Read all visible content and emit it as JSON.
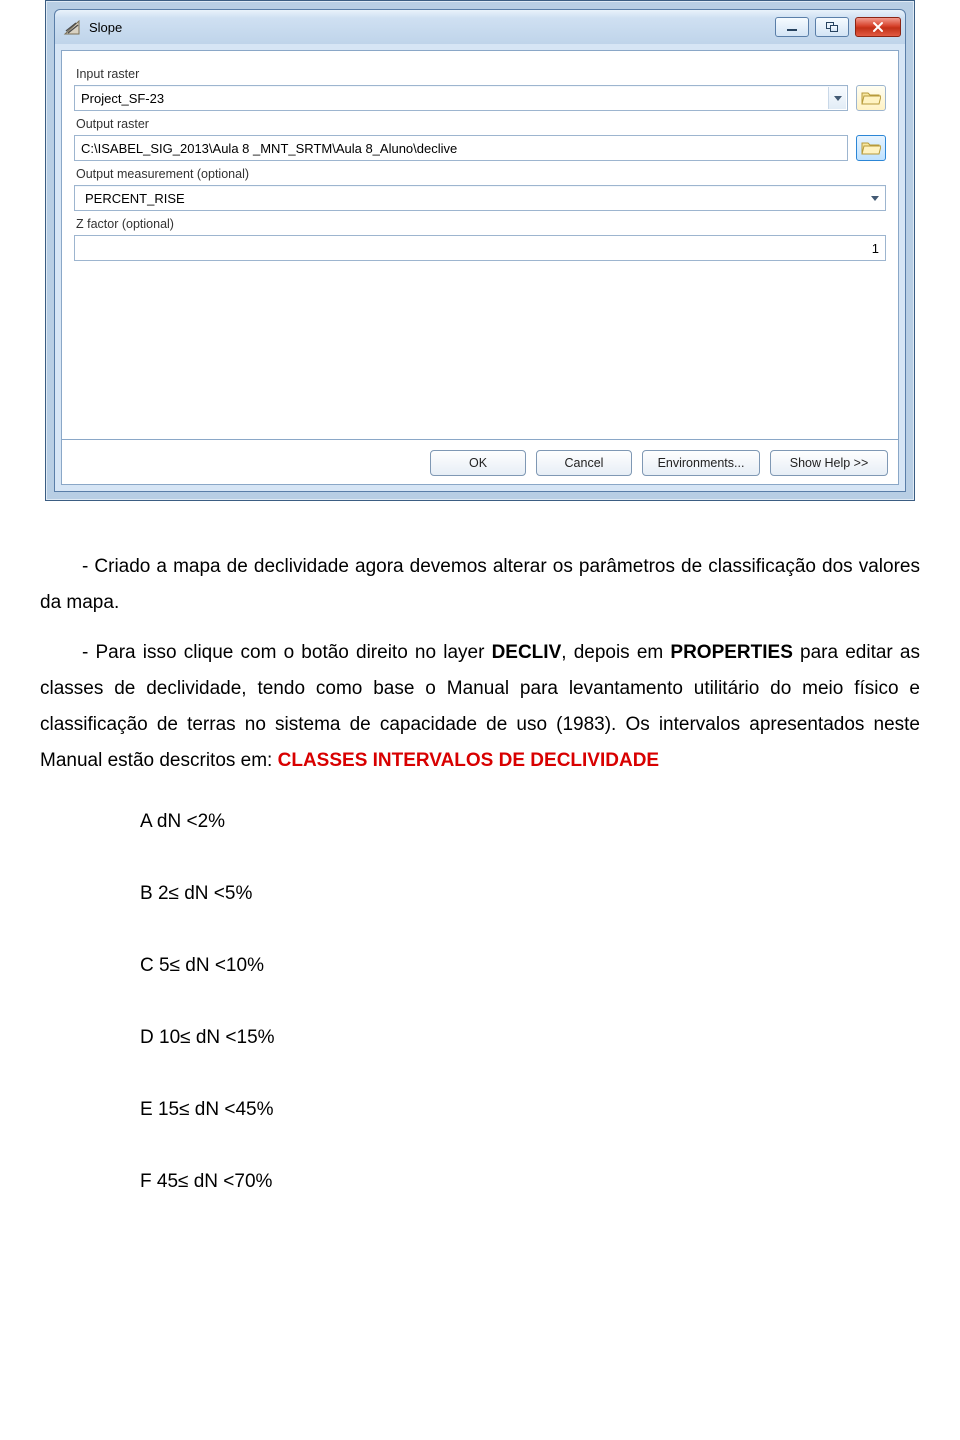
{
  "dialog": {
    "title": "Slope",
    "fields": {
      "input_raster": {
        "label": "Input raster",
        "value": "Project_SF-23"
      },
      "output_raster": {
        "label": "Output raster",
        "value": "C:\\ISABEL_SIG_2013\\Aula 8 _MNT_SRTM\\Aula 8_Aluno\\declive"
      },
      "output_measurement": {
        "label": "Output measurement (optional)",
        "value": "PERCENT_RISE"
      },
      "z_factor": {
        "label": "Z factor (optional)",
        "value": "1"
      }
    },
    "buttons": {
      "ok": "OK",
      "cancel": "Cancel",
      "env": "Environments...",
      "help": "Show Help >>"
    }
  },
  "text": {
    "p1_a": "- Criado a mapa de declividade agora devemos alterar os parâmetros de classificação dos valores da mapa.",
    "p2_a": "- Para isso clique com o botão direito no layer ",
    "p2_b": "DECLIV",
    "p2_c": ", depois em ",
    "p2_d": "PROPERTIES",
    "p2_e": " para editar as classes de declividade, tendo como base o Manual para levantamento utilitário do meio físico e classificação de terras no sistema de capacidade de uso (1983). Os intervalos apresentados neste Manual estão descritos em: ",
    "p2_f": "CLASSES INTERVALOS DE DECLIVIDADE"
  },
  "intervals": [
    "A dN <2%",
    "B 2≤ dN <5%",
    "C 5≤ dN <10%",
    "D 10≤ dN <15%",
    "E 15≤ dN <45%",
    "F 45≤ dN <70%"
  ]
}
